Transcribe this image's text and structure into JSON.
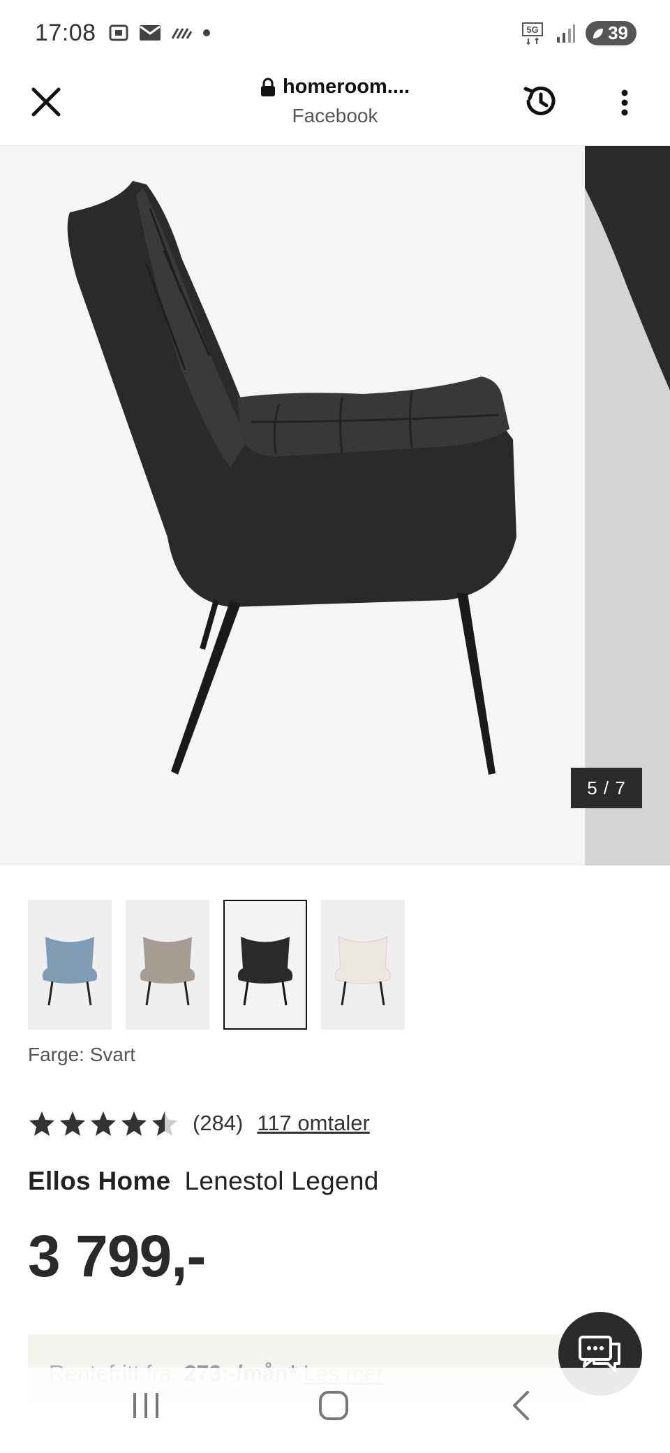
{
  "status_bar": {
    "time": "17:08",
    "battery": "39",
    "network": "5G"
  },
  "browser": {
    "url": "homeroom....",
    "source": "Facebook"
  },
  "gallery": {
    "counter": "5 / 7"
  },
  "swatches": [
    {
      "color": "#7f9cb5",
      "name": "blue"
    },
    {
      "color": "#a79e93",
      "name": "beige"
    },
    {
      "color": "#2a2a2a",
      "name": "black"
    },
    {
      "color": "#ece8df",
      "name": "white"
    }
  ],
  "selected_swatch_index": 2,
  "color_label": "Farge: Svart",
  "rating": {
    "stars": 4.5,
    "count": "(284)",
    "reviews_link": "117 omtaler"
  },
  "product": {
    "brand": "Ellos Home",
    "name": "Lenestol Legend",
    "price": "3 799,-"
  },
  "financing": {
    "prefix": "Rentefritt fra.",
    "amount": "273:-/mån*",
    "link": "Les mer"
  }
}
